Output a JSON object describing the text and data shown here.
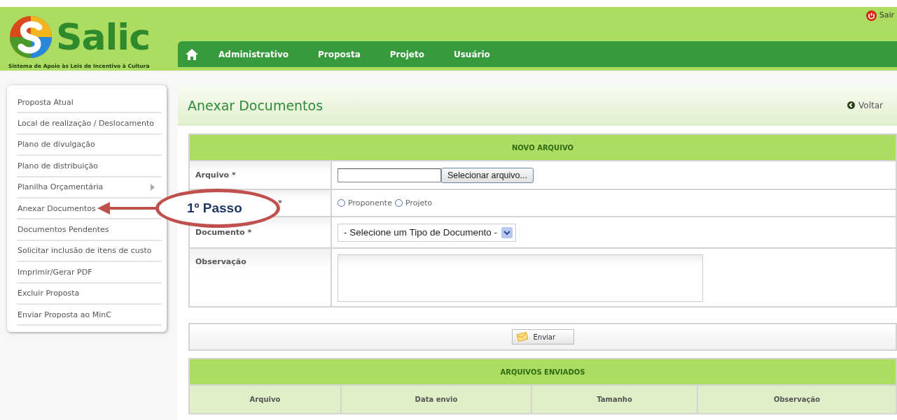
{
  "header": {
    "logo_text": "Salic",
    "tagline": "Sistema de Apoio às Leis de Incentivo à Cultura",
    "logout": "Sair"
  },
  "nav": {
    "items": [
      "Administrativo",
      "Proposta",
      "Projeto",
      "Usuário"
    ]
  },
  "sidebar": {
    "items": [
      {
        "label": "Proposta Atual",
        "has_submenu": false
      },
      {
        "label": "Local de realização / Deslocamento",
        "has_submenu": false
      },
      {
        "label": "Plano de divulgação",
        "has_submenu": false
      },
      {
        "label": "Plano de distribuição",
        "has_submenu": false
      },
      {
        "label": "Planilha Orçamentária",
        "has_submenu": true
      },
      {
        "label": "Anexar Documentos",
        "has_submenu": false
      },
      {
        "label": "Documentos Pendentes",
        "has_submenu": false
      },
      {
        "label": "Solicitar inclusão de itens de custo",
        "has_submenu": false
      },
      {
        "label": "Imprimir/Gerar PDF",
        "has_submenu": false
      },
      {
        "label": "Excluir Proposta",
        "has_submenu": false
      },
      {
        "label": "Enviar Proposta ao MinC",
        "has_submenu": false
      }
    ]
  },
  "page": {
    "title": "Anexar Documentos",
    "back": "Voltar"
  },
  "form": {
    "heading": "NOVO ARQUIVO",
    "rows": [
      {
        "kind": "file",
        "label": "Arquivo *",
        "button": "Selecionar arquivo..."
      },
      {
        "kind": "radio",
        "label": "*",
        "options": [
          {
            "label": "Proponente",
            "selected": false
          },
          {
            "label": "Projeto",
            "selected": false
          }
        ]
      },
      {
        "kind": "select",
        "label": "Documento *",
        "value": "- Selecione um Tipo de Documento -"
      },
      {
        "kind": "textarea",
        "label": "Observação"
      }
    ],
    "submit": "Enviar"
  },
  "sent_table": {
    "heading": "ARQUIVOS ENVIADOS",
    "columns": [
      "Arquivo",
      "Data envio",
      "Tamanho",
      "Observação"
    ]
  },
  "annotation": {
    "text": "1º Passo"
  }
}
